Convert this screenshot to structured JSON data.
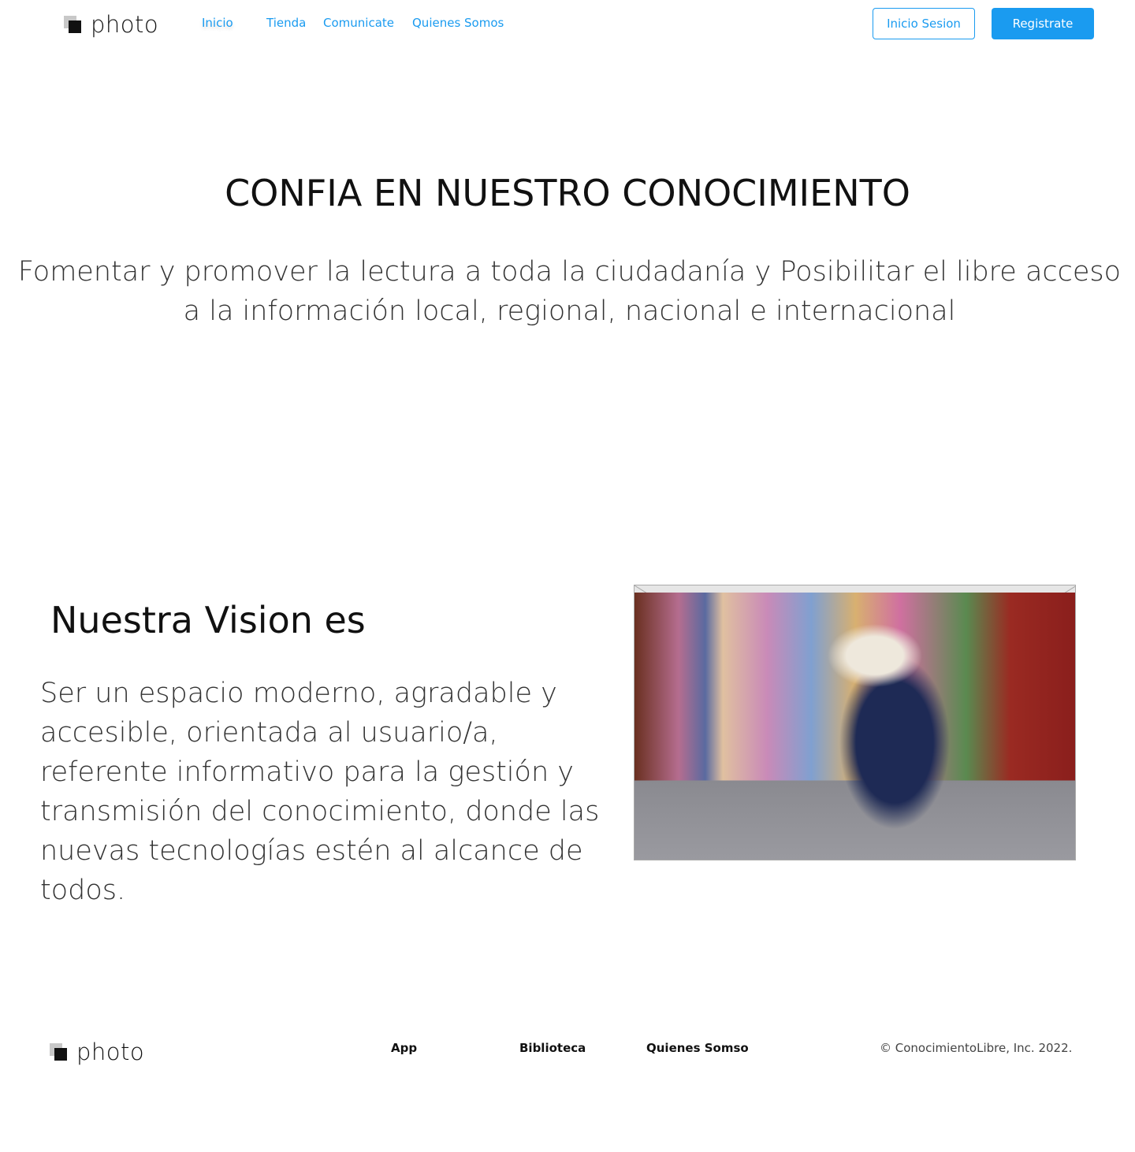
{
  "header": {
    "logo_text": "photo",
    "nav": [
      "Inicio",
      "Tienda",
      "Comunicate",
      "Quienes Somos"
    ],
    "login_label": "Inicio Sesion",
    "register_label": "Registrate"
  },
  "hero": {
    "title": "CONFIA EN NUESTRO CONOCIMIENTO",
    "subtitle": "Fomentar y promover la lectura a toda la ciudadanía y Posibilitar el libre acceso a la información local, regional, nacional e internacional"
  },
  "vision": {
    "title": "Nuestra Vision es",
    "text": "Ser un espacio moderno, agradable y accesible, orientada al usuario/a, referente informativo para la gestión y transmisión del conocimiento, donde las nuevas tecnologías estén al alcance de todos."
  },
  "footer": {
    "logo_text": "photo",
    "links": [
      "App",
      "Biblioteca",
      "Quienes Somso"
    ],
    "copyright": "© ConocimientoLibre, Inc. 2022."
  },
  "colors": {
    "accent": "#1a9bf0"
  }
}
